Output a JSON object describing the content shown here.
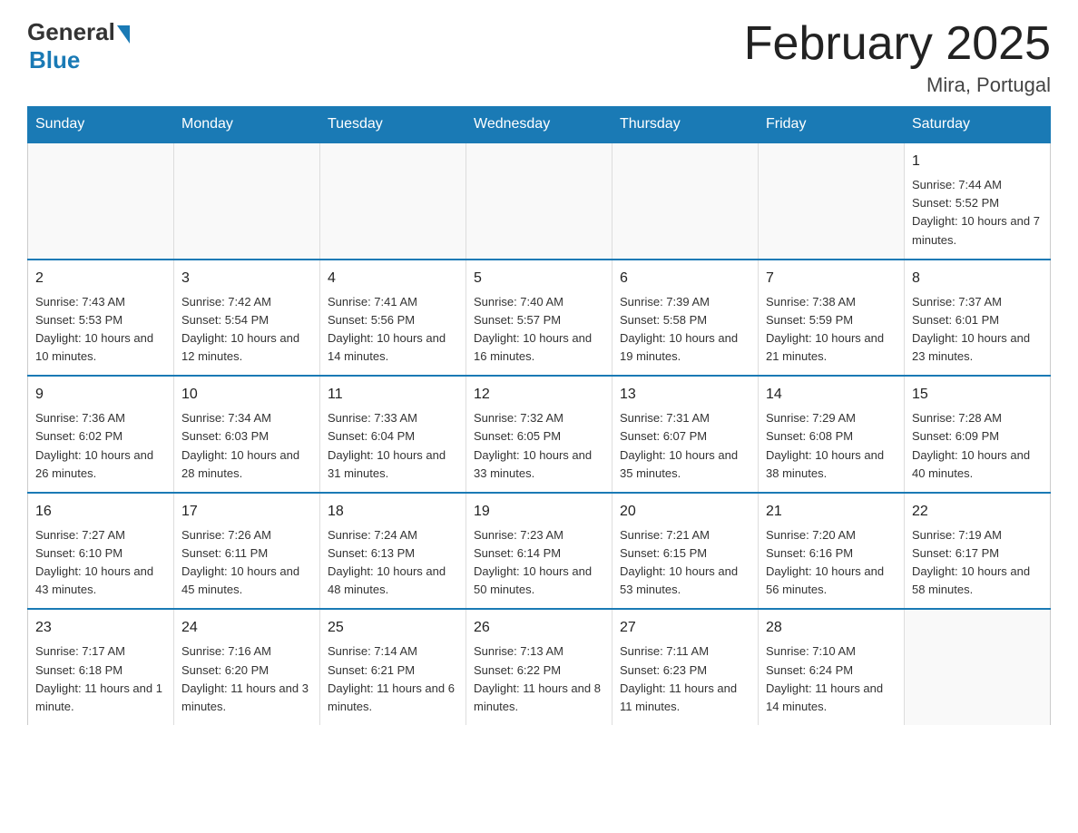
{
  "logo": {
    "general": "General",
    "blue": "Blue"
  },
  "title": "February 2025",
  "location": "Mira, Portugal",
  "weekdays": [
    "Sunday",
    "Monday",
    "Tuesday",
    "Wednesday",
    "Thursday",
    "Friday",
    "Saturday"
  ],
  "weeks": [
    [
      {
        "day": "",
        "info": ""
      },
      {
        "day": "",
        "info": ""
      },
      {
        "day": "",
        "info": ""
      },
      {
        "day": "",
        "info": ""
      },
      {
        "day": "",
        "info": ""
      },
      {
        "day": "",
        "info": ""
      },
      {
        "day": "1",
        "info": "Sunrise: 7:44 AM\nSunset: 5:52 PM\nDaylight: 10 hours and 7 minutes."
      }
    ],
    [
      {
        "day": "2",
        "info": "Sunrise: 7:43 AM\nSunset: 5:53 PM\nDaylight: 10 hours and 10 minutes."
      },
      {
        "day": "3",
        "info": "Sunrise: 7:42 AM\nSunset: 5:54 PM\nDaylight: 10 hours and 12 minutes."
      },
      {
        "day": "4",
        "info": "Sunrise: 7:41 AM\nSunset: 5:56 PM\nDaylight: 10 hours and 14 minutes."
      },
      {
        "day": "5",
        "info": "Sunrise: 7:40 AM\nSunset: 5:57 PM\nDaylight: 10 hours and 16 minutes."
      },
      {
        "day": "6",
        "info": "Sunrise: 7:39 AM\nSunset: 5:58 PM\nDaylight: 10 hours and 19 minutes."
      },
      {
        "day": "7",
        "info": "Sunrise: 7:38 AM\nSunset: 5:59 PM\nDaylight: 10 hours and 21 minutes."
      },
      {
        "day": "8",
        "info": "Sunrise: 7:37 AM\nSunset: 6:01 PM\nDaylight: 10 hours and 23 minutes."
      }
    ],
    [
      {
        "day": "9",
        "info": "Sunrise: 7:36 AM\nSunset: 6:02 PM\nDaylight: 10 hours and 26 minutes."
      },
      {
        "day": "10",
        "info": "Sunrise: 7:34 AM\nSunset: 6:03 PM\nDaylight: 10 hours and 28 minutes."
      },
      {
        "day": "11",
        "info": "Sunrise: 7:33 AM\nSunset: 6:04 PM\nDaylight: 10 hours and 31 minutes."
      },
      {
        "day": "12",
        "info": "Sunrise: 7:32 AM\nSunset: 6:05 PM\nDaylight: 10 hours and 33 minutes."
      },
      {
        "day": "13",
        "info": "Sunrise: 7:31 AM\nSunset: 6:07 PM\nDaylight: 10 hours and 35 minutes."
      },
      {
        "day": "14",
        "info": "Sunrise: 7:29 AM\nSunset: 6:08 PM\nDaylight: 10 hours and 38 minutes."
      },
      {
        "day": "15",
        "info": "Sunrise: 7:28 AM\nSunset: 6:09 PM\nDaylight: 10 hours and 40 minutes."
      }
    ],
    [
      {
        "day": "16",
        "info": "Sunrise: 7:27 AM\nSunset: 6:10 PM\nDaylight: 10 hours and 43 minutes."
      },
      {
        "day": "17",
        "info": "Sunrise: 7:26 AM\nSunset: 6:11 PM\nDaylight: 10 hours and 45 minutes."
      },
      {
        "day": "18",
        "info": "Sunrise: 7:24 AM\nSunset: 6:13 PM\nDaylight: 10 hours and 48 minutes."
      },
      {
        "day": "19",
        "info": "Sunrise: 7:23 AM\nSunset: 6:14 PM\nDaylight: 10 hours and 50 minutes."
      },
      {
        "day": "20",
        "info": "Sunrise: 7:21 AM\nSunset: 6:15 PM\nDaylight: 10 hours and 53 minutes."
      },
      {
        "day": "21",
        "info": "Sunrise: 7:20 AM\nSunset: 6:16 PM\nDaylight: 10 hours and 56 minutes."
      },
      {
        "day": "22",
        "info": "Sunrise: 7:19 AM\nSunset: 6:17 PM\nDaylight: 10 hours and 58 minutes."
      }
    ],
    [
      {
        "day": "23",
        "info": "Sunrise: 7:17 AM\nSunset: 6:18 PM\nDaylight: 11 hours and 1 minute."
      },
      {
        "day": "24",
        "info": "Sunrise: 7:16 AM\nSunset: 6:20 PM\nDaylight: 11 hours and 3 minutes."
      },
      {
        "day": "25",
        "info": "Sunrise: 7:14 AM\nSunset: 6:21 PM\nDaylight: 11 hours and 6 minutes."
      },
      {
        "day": "26",
        "info": "Sunrise: 7:13 AM\nSunset: 6:22 PM\nDaylight: 11 hours and 8 minutes."
      },
      {
        "day": "27",
        "info": "Sunrise: 7:11 AM\nSunset: 6:23 PM\nDaylight: 11 hours and 11 minutes."
      },
      {
        "day": "28",
        "info": "Sunrise: 7:10 AM\nSunset: 6:24 PM\nDaylight: 11 hours and 14 minutes."
      },
      {
        "day": "",
        "info": ""
      }
    ]
  ]
}
